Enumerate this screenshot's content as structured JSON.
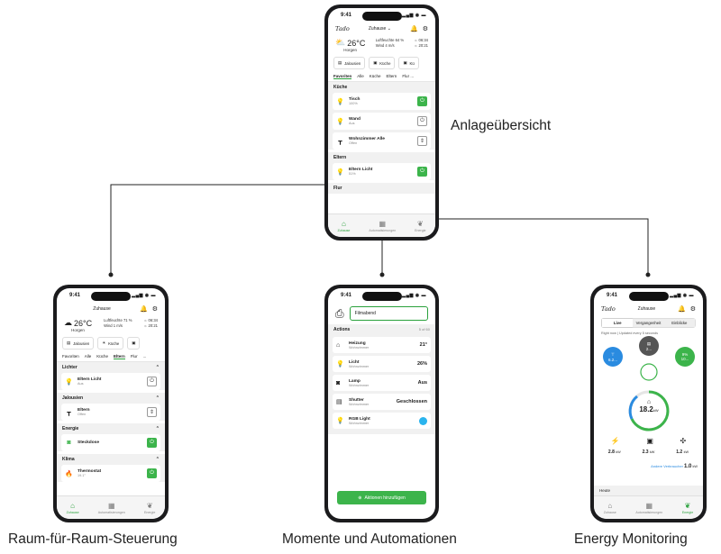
{
  "captions": {
    "top": "Anlageübersicht",
    "left": "Raum-für-Raum-Steuerung",
    "middle": "Momente und Automationen",
    "right": "Energy Monitoring"
  },
  "colors": {
    "accent": "#3cb44b",
    "blue": "#2a8be0",
    "yellow": "#f2b705",
    "cyan": "#2ab4ee"
  },
  "top_phone": {
    "time": "9:41",
    "logo": "Tado",
    "home": "Zuhause ⌄",
    "temp": "26°C",
    "humidity": "Luftfeuchte 64 %",
    "location": "Horgen",
    "wind": "Wind 4 m/s",
    "sunrise": "06:34",
    "sunset": "20:21",
    "shortcuts": [
      "Jalousien",
      "Küche",
      "Kü"
    ],
    "tabs": [
      "Favoriten",
      "Alle",
      "Küche",
      "Eltern",
      "Flur ..."
    ],
    "sec1": "Küche",
    "d1_name": "Tisch",
    "d1_state": "100%",
    "d2_name": "Wand",
    "d2_state": "Aus",
    "d3_name": "Wohnzimmer Alle",
    "d3_state": "Offen",
    "sec2": "Eltern",
    "d4_name": "Eltern Licht",
    "d4_state": "51%",
    "sec3": "Flur",
    "nav": [
      "Zuhause",
      "Automatisierungen",
      "Energie"
    ]
  },
  "left_phone": {
    "time": "9:41",
    "home": "Zuhause",
    "temp": "26°C",
    "humidity": "Luftfeuchte 71 %",
    "location": "Horgen",
    "wind": "Wind 1 m/s",
    "sunrise": "06:34",
    "sunset": "20:21",
    "shortcuts": [
      "Jalousien",
      "Küche"
    ],
    "tabs": [
      "Favoriten",
      "Alle",
      "Küche",
      "Eltern",
      "Flur",
      "..."
    ],
    "sec1": "Lichter",
    "d1_name": "Eltern Licht",
    "d1_state": "Aus",
    "sec2": "Jalousien",
    "d2_name": "Eltern",
    "d2_state": "Offen",
    "sec3": "Energie",
    "d3_name": "Steckdose",
    "sec4": "Klima",
    "d4_name": "Thermostat",
    "d4_state": "19.1°",
    "nav": [
      "Zuhause",
      "Automatisierungen",
      "Energie"
    ]
  },
  "middle_phone": {
    "time": "9:41",
    "scene_name": "Filmabend",
    "actions_label": "Actions",
    "actions_count": "5 of 60",
    "a1_name": "Heizung",
    "a1_room": "Wohnzimmer",
    "a1_val": "21°",
    "a2_name": "Licht",
    "a2_room": "Wohnzimmer",
    "a2_val": "26%",
    "a3_name": "Lamp",
    "a3_room": "Wohnzimmer",
    "a3_val": "Aus",
    "a4_name": "Shutter",
    "a4_room": "Wohnzimmer",
    "a4_val": "Geschlossen",
    "a5_name": "RGB Light",
    "a5_room": "Wohnzimmer",
    "add_label": "Aktionen hinzufügen"
  },
  "right_phone": {
    "time": "9:41",
    "home": "Zuhause",
    "seg": [
      "Live",
      "Vergangenheit",
      "Einblicke"
    ],
    "right_now": "Right now  |  Updated every 5 seconds",
    "solar": "6.2...",
    "grid": "2...",
    "battery_pct": "9%",
    "battery_val": "10...",
    "house_val": "18.2",
    "house_unit": "kW",
    "s1": "2.8",
    "s2": "2.3",
    "s3": "1.2",
    "unit": "kW",
    "other_label": "Andere Verbraucher",
    "other_val": "1.0",
    "heute": "Heute",
    "nav": [
      "Zuhause",
      "Automatisierungen",
      "Energie"
    ]
  }
}
